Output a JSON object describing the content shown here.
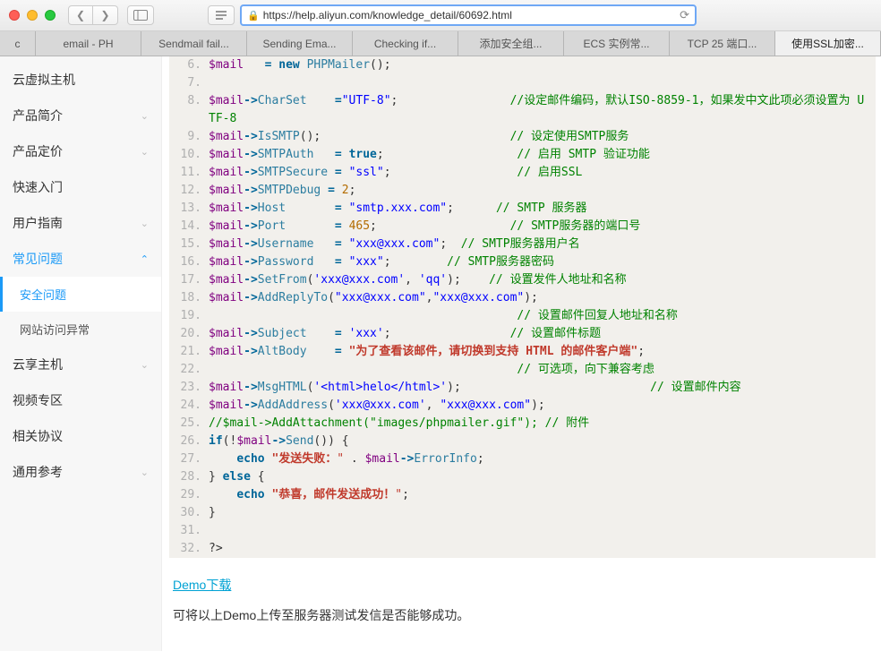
{
  "window": {
    "url": "https://help.aliyun.com/knowledge_detail/60692.html"
  },
  "tabs": [
    {
      "label": "c"
    },
    {
      "label": "email - PH"
    },
    {
      "label": "Sendmail fail..."
    },
    {
      "label": "Sending Ema..."
    },
    {
      "label": "Checking if..."
    },
    {
      "label": "添加安全组..."
    },
    {
      "label": "ECS 实例常..."
    },
    {
      "label": "TCP 25 端口..."
    },
    {
      "label": "使用SSL加密..."
    }
  ],
  "sidebar": {
    "items": [
      {
        "label": "云虚拟主机",
        "expand": false,
        "chev": ""
      },
      {
        "label": "产品简介",
        "expand": false,
        "chev": "⌄"
      },
      {
        "label": "产品定价",
        "expand": false,
        "chev": "⌄"
      },
      {
        "label": "快速入门",
        "expand": false,
        "chev": ""
      },
      {
        "label": "用户指南",
        "expand": false,
        "chev": "⌄"
      },
      {
        "label": "常见问题",
        "expand": true,
        "chev": "⌃",
        "children": [
          {
            "label": "安全问题",
            "active": true
          },
          {
            "label": "网站访问异常",
            "active": false
          }
        ]
      },
      {
        "label": "云享主机",
        "expand": false,
        "chev": "⌄"
      },
      {
        "label": "视频专区",
        "expand": false,
        "chev": ""
      },
      {
        "label": "相关协议",
        "expand": false,
        "chev": ""
      },
      {
        "label": "通用参考",
        "expand": false,
        "chev": "⌄"
      }
    ]
  },
  "code": {
    "start": 6,
    "lines": [
      [
        [
          "var",
          "$mail"
        ],
        [
          "p",
          "   "
        ],
        [
          "op",
          "="
        ],
        [
          "p",
          " "
        ],
        [
          "kw",
          "new"
        ],
        [
          "p",
          " "
        ],
        [
          "cls",
          "PHPMailer"
        ],
        [
          "p",
          "();"
        ]
      ],
      [],
      [
        [
          "var",
          "$mail"
        ],
        [
          "op",
          "->"
        ],
        [
          "cls",
          "CharSet"
        ],
        [
          "p",
          "    "
        ],
        [
          "op",
          "="
        ],
        [
          "str",
          "\"UTF-8\""
        ],
        [
          "p",
          ";                "
        ],
        [
          "cmt",
          "//设定邮件编码，默认ISO-8859-1，如果发中文此项必须设置为 UTF-8"
        ]
      ],
      [
        [
          "var",
          "$mail"
        ],
        [
          "op",
          "->"
        ],
        [
          "cls",
          "IsSMTP"
        ],
        [
          "p",
          "();                           "
        ],
        [
          "cmt",
          "// 设定使用SMTP服务"
        ]
      ],
      [
        [
          "var",
          "$mail"
        ],
        [
          "op",
          "->"
        ],
        [
          "cls",
          "SMTPAuth"
        ],
        [
          "p",
          "   "
        ],
        [
          "op",
          "="
        ],
        [
          "p",
          " "
        ],
        [
          "kw",
          "true"
        ],
        [
          "p",
          ";                   "
        ],
        [
          "cmt",
          "// 启用 SMTP 验证功能"
        ]
      ],
      [
        [
          "var",
          "$mail"
        ],
        [
          "op",
          "->"
        ],
        [
          "cls",
          "SMTPSecure"
        ],
        [
          "p",
          " "
        ],
        [
          "op",
          "="
        ],
        [
          "p",
          " "
        ],
        [
          "str",
          "\"ssl\""
        ],
        [
          "p",
          ";                  "
        ],
        [
          "cmt",
          "// 启用SSL"
        ]
      ],
      [
        [
          "var",
          "$mail"
        ],
        [
          "op",
          "->"
        ],
        [
          "cls",
          "SMTPDebug"
        ],
        [
          "p",
          " "
        ],
        [
          "op",
          "="
        ],
        [
          "p",
          " "
        ],
        [
          "num",
          "2"
        ],
        [
          "p",
          ";"
        ]
      ],
      [
        [
          "var",
          "$mail"
        ],
        [
          "op",
          "->"
        ],
        [
          "cls",
          "Host"
        ],
        [
          "p",
          "       "
        ],
        [
          "op",
          "="
        ],
        [
          "p",
          " "
        ],
        [
          "str",
          "\"smtp.xxx.com\""
        ],
        [
          "p",
          ";      "
        ],
        [
          "cmt",
          "// SMTP 服务器"
        ]
      ],
      [
        [
          "var",
          "$mail"
        ],
        [
          "op",
          "->"
        ],
        [
          "cls",
          "Port"
        ],
        [
          "p",
          "       "
        ],
        [
          "op",
          "="
        ],
        [
          "p",
          " "
        ],
        [
          "num",
          "465"
        ],
        [
          "p",
          ";                   "
        ],
        [
          "cmt",
          "// SMTP服务器的端口号"
        ]
      ],
      [
        [
          "var",
          "$mail"
        ],
        [
          "op",
          "->"
        ],
        [
          "cls",
          "Username"
        ],
        [
          "p",
          "   "
        ],
        [
          "op",
          "="
        ],
        [
          "p",
          " "
        ],
        [
          "str",
          "\"xxx@xxx.com\""
        ],
        [
          "p",
          ";  "
        ],
        [
          "cmt",
          "// SMTP服务器用户名"
        ]
      ],
      [
        [
          "var",
          "$mail"
        ],
        [
          "op",
          "->"
        ],
        [
          "cls",
          "Password"
        ],
        [
          "p",
          "   "
        ],
        [
          "op",
          "="
        ],
        [
          "p",
          " "
        ],
        [
          "str",
          "\"xxx\""
        ],
        [
          "p",
          ";        "
        ],
        [
          "cmt",
          "// SMTP服务器密码"
        ]
      ],
      [
        [
          "var",
          "$mail"
        ],
        [
          "op",
          "->"
        ],
        [
          "cls",
          "SetFrom"
        ],
        [
          "p",
          "("
        ],
        [
          "str",
          "'xxx@xxx.com'"
        ],
        [
          "p",
          ", "
        ],
        [
          "str",
          "'qq'"
        ],
        [
          "p",
          ");    "
        ],
        [
          "cmt",
          "// 设置发件人地址和名称"
        ]
      ],
      [
        [
          "var",
          "$mail"
        ],
        [
          "op",
          "->"
        ],
        [
          "cls",
          "AddReplyTo"
        ],
        [
          "p",
          "("
        ],
        [
          "str",
          "\"xxx@xxx.com\""
        ],
        [
          "p",
          ","
        ],
        [
          "str",
          "\"xxx@xxx.com\""
        ],
        [
          "p",
          ");"
        ]
      ],
      [
        [
          "p",
          "                                            "
        ],
        [
          "cmt",
          "// 设置邮件回复人地址和名称"
        ]
      ],
      [
        [
          "var",
          "$mail"
        ],
        [
          "op",
          "->"
        ],
        [
          "cls",
          "Subject"
        ],
        [
          "p",
          "    "
        ],
        [
          "op",
          "="
        ],
        [
          "p",
          " "
        ],
        [
          "str",
          "'xxx'"
        ],
        [
          "p",
          ";                 "
        ],
        [
          "cmt",
          "// 设置邮件标题"
        ]
      ],
      [
        [
          "var",
          "$mail"
        ],
        [
          "op",
          "->"
        ],
        [
          "cls",
          "AltBody"
        ],
        [
          "p",
          "    "
        ],
        [
          "op",
          "="
        ],
        [
          "p",
          " "
        ],
        [
          "strcn",
          "\"为了查看该邮件，请切换到支持 HTML 的邮件客户端\""
        ],
        [
          "p",
          ";"
        ]
      ],
      [
        [
          "p",
          "                                            "
        ],
        [
          "cmt",
          "// 可选项，向下兼容考虑"
        ]
      ],
      [
        [
          "var",
          "$mail"
        ],
        [
          "op",
          "->"
        ],
        [
          "cls",
          "MsgHTML"
        ],
        [
          "p",
          "("
        ],
        [
          "str",
          "'<html>helo</html>'"
        ],
        [
          "p",
          ");                           "
        ],
        [
          "cmt",
          "// 设置邮件内容"
        ]
      ],
      [
        [
          "var",
          "$mail"
        ],
        [
          "op",
          "->"
        ],
        [
          "cls",
          "AddAddress"
        ],
        [
          "p",
          "("
        ],
        [
          "str",
          "'xxx@xxx.com'"
        ],
        [
          "p",
          ", "
        ],
        [
          "str",
          "\"xxx@xxx.com\""
        ],
        [
          "p",
          ");"
        ]
      ],
      [
        [
          "cmt",
          "//$mail->AddAttachment(\"images/phpmailer.gif\"); // 附件"
        ]
      ],
      [
        [
          "kw",
          "if"
        ],
        [
          "p",
          "(!"
        ],
        [
          "var",
          "$mail"
        ],
        [
          "op",
          "->"
        ],
        [
          "cls",
          "Send"
        ],
        [
          "p",
          "()) {"
        ]
      ],
      [
        [
          "p",
          "    "
        ],
        [
          "kw",
          "echo"
        ],
        [
          "p",
          " "
        ],
        [
          "strcn",
          "\"发送失败："
        ],
        [
          "circ",
          "\""
        ],
        [
          "p",
          " . "
        ],
        [
          "var",
          "$mail"
        ],
        [
          "op",
          "->"
        ],
        [
          "cls",
          "ErrorInfo"
        ],
        [
          "p",
          ";"
        ]
      ],
      [
        [
          "p",
          "} "
        ],
        [
          "kw",
          "else"
        ],
        [
          "p",
          " {"
        ]
      ],
      [
        [
          "p",
          "    "
        ],
        [
          "kw",
          "echo"
        ],
        [
          "p",
          " "
        ],
        [
          "strcn",
          "\"恭喜，邮件发送成功！"
        ],
        [
          "circ",
          "\""
        ],
        [
          "p",
          ";"
        ]
      ],
      [
        [
          "p",
          "}"
        ]
      ],
      [],
      [
        [
          "p",
          "?>"
        ]
      ]
    ]
  },
  "downlink": "Demo下载",
  "note": "可将以上Demo上传至服务器测试发信是否能够成功。"
}
